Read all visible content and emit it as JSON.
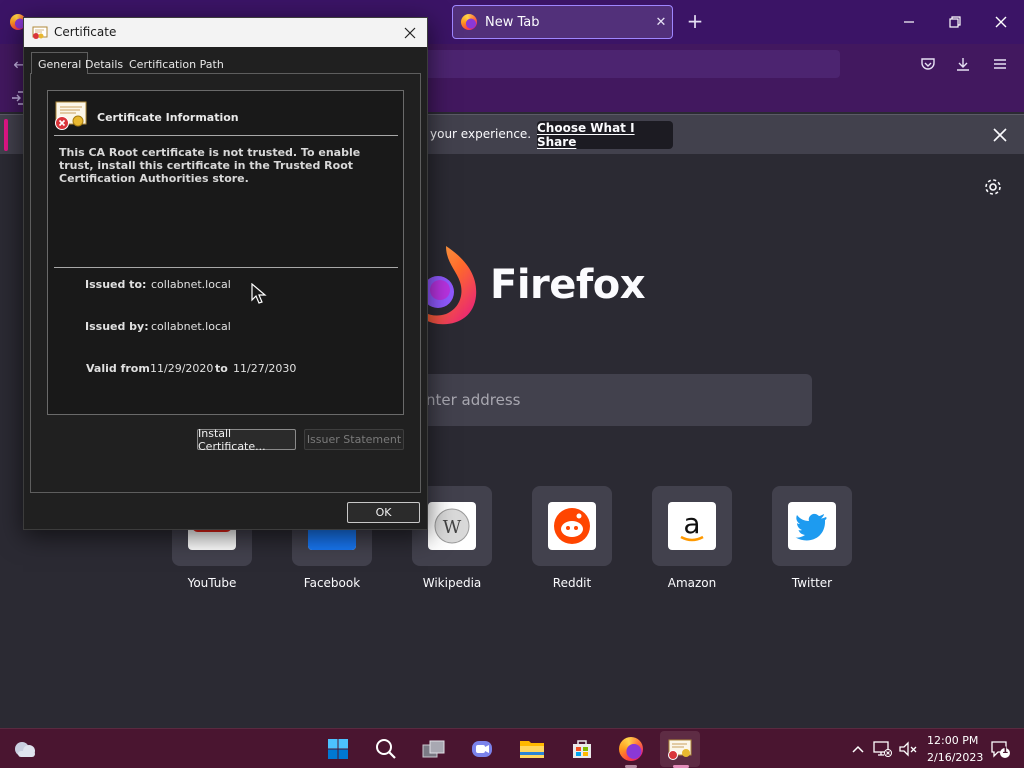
{
  "browser": {
    "tab_title": "New Tab",
    "tab_close": "✕",
    "new_tab_plus": "+",
    "notification": {
      "text": "your experience.",
      "button": "Choose What I Share"
    },
    "search_placeholder": "nter address",
    "wordmark": "Firefox",
    "shortcuts": [
      {
        "label": "YouTube"
      },
      {
        "label": "Facebook"
      },
      {
        "label": "Wikipedia"
      },
      {
        "label": "Reddit"
      },
      {
        "label": "Amazon"
      },
      {
        "label": "Twitter"
      }
    ]
  },
  "dialog": {
    "title": "Certificate",
    "tabs": {
      "general": "General",
      "details": "Details",
      "path": "Certification Path"
    },
    "info_heading": "Certificate Information",
    "warning": "This CA Root certificate is not trusted. To enable trust, install this certificate in the Trusted Root Certification Authorities store.",
    "issued_to_label": "Issued to:",
    "issued_to": "collabnet.local",
    "issued_by_label": "Issued by:",
    "issued_by": "collabnet.local",
    "valid_from_label": "Valid from",
    "valid_from": "11/29/2020",
    "valid_to_word": "to",
    "valid_to": "11/27/2030",
    "install_button": "Install Certificate...",
    "issuer_button": "Issuer Statement",
    "ok_button": "OK"
  },
  "taskbar": {
    "time": "12:00 PM",
    "date": "2/16/2023",
    "notification_count": "1"
  },
  "colors": {
    "titlebar": "#3b1466",
    "accent_tab_border": "#9f86ff",
    "taskbar": "#4a1530",
    "newtab_bg": "#2b2a33"
  }
}
